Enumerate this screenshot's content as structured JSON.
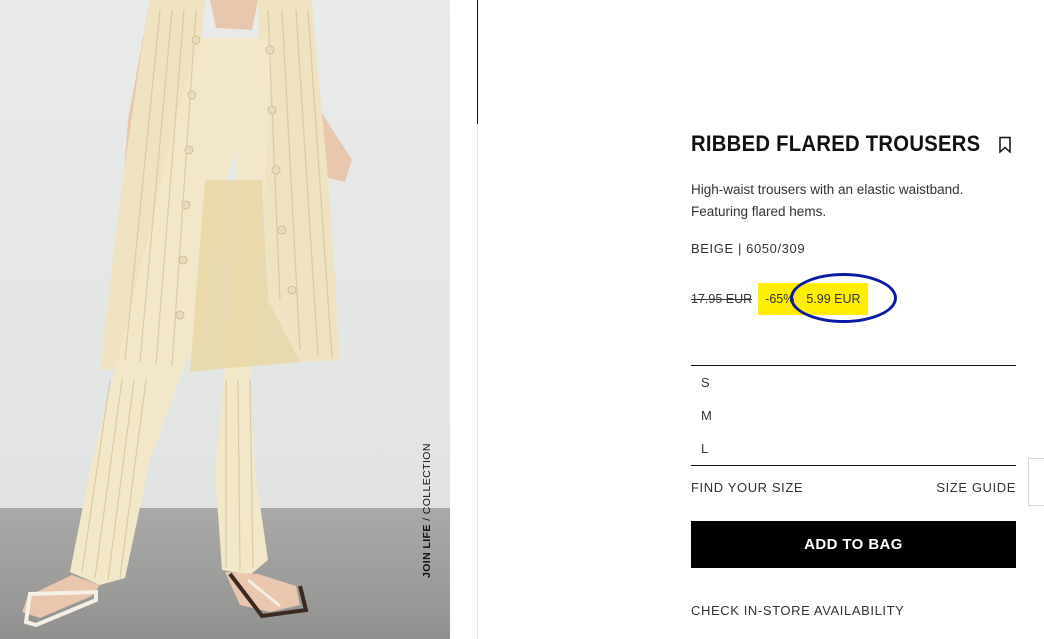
{
  "product": {
    "image_alt": "Model wearing ribbed flared trousers and long ribbed cardigan",
    "image_caption_bold": "JOIN LIFE",
    "image_caption_rest": " / COLLECTION",
    "title": "RIBBED FLARED TROUSERS",
    "description": "High-waist trousers with an elastic waistband. Featuring flared hems.",
    "color_ref": "BEIGE | 6050/309"
  },
  "price": {
    "old": "17.95 EUR",
    "discount": "-65%",
    "current": "5.99 EUR",
    "sale_color": "#ffee00",
    "annotation_color": "#0a1aa6"
  },
  "sizes": [
    "S",
    "M",
    "L"
  ],
  "links": {
    "find_your_size": "FIND YOUR SIZE",
    "size_guide": "SIZE GUIDE",
    "check_store": "CHECK IN-STORE AVAILABILITY"
  },
  "actions": {
    "add_to_bag": "ADD TO BAG"
  }
}
